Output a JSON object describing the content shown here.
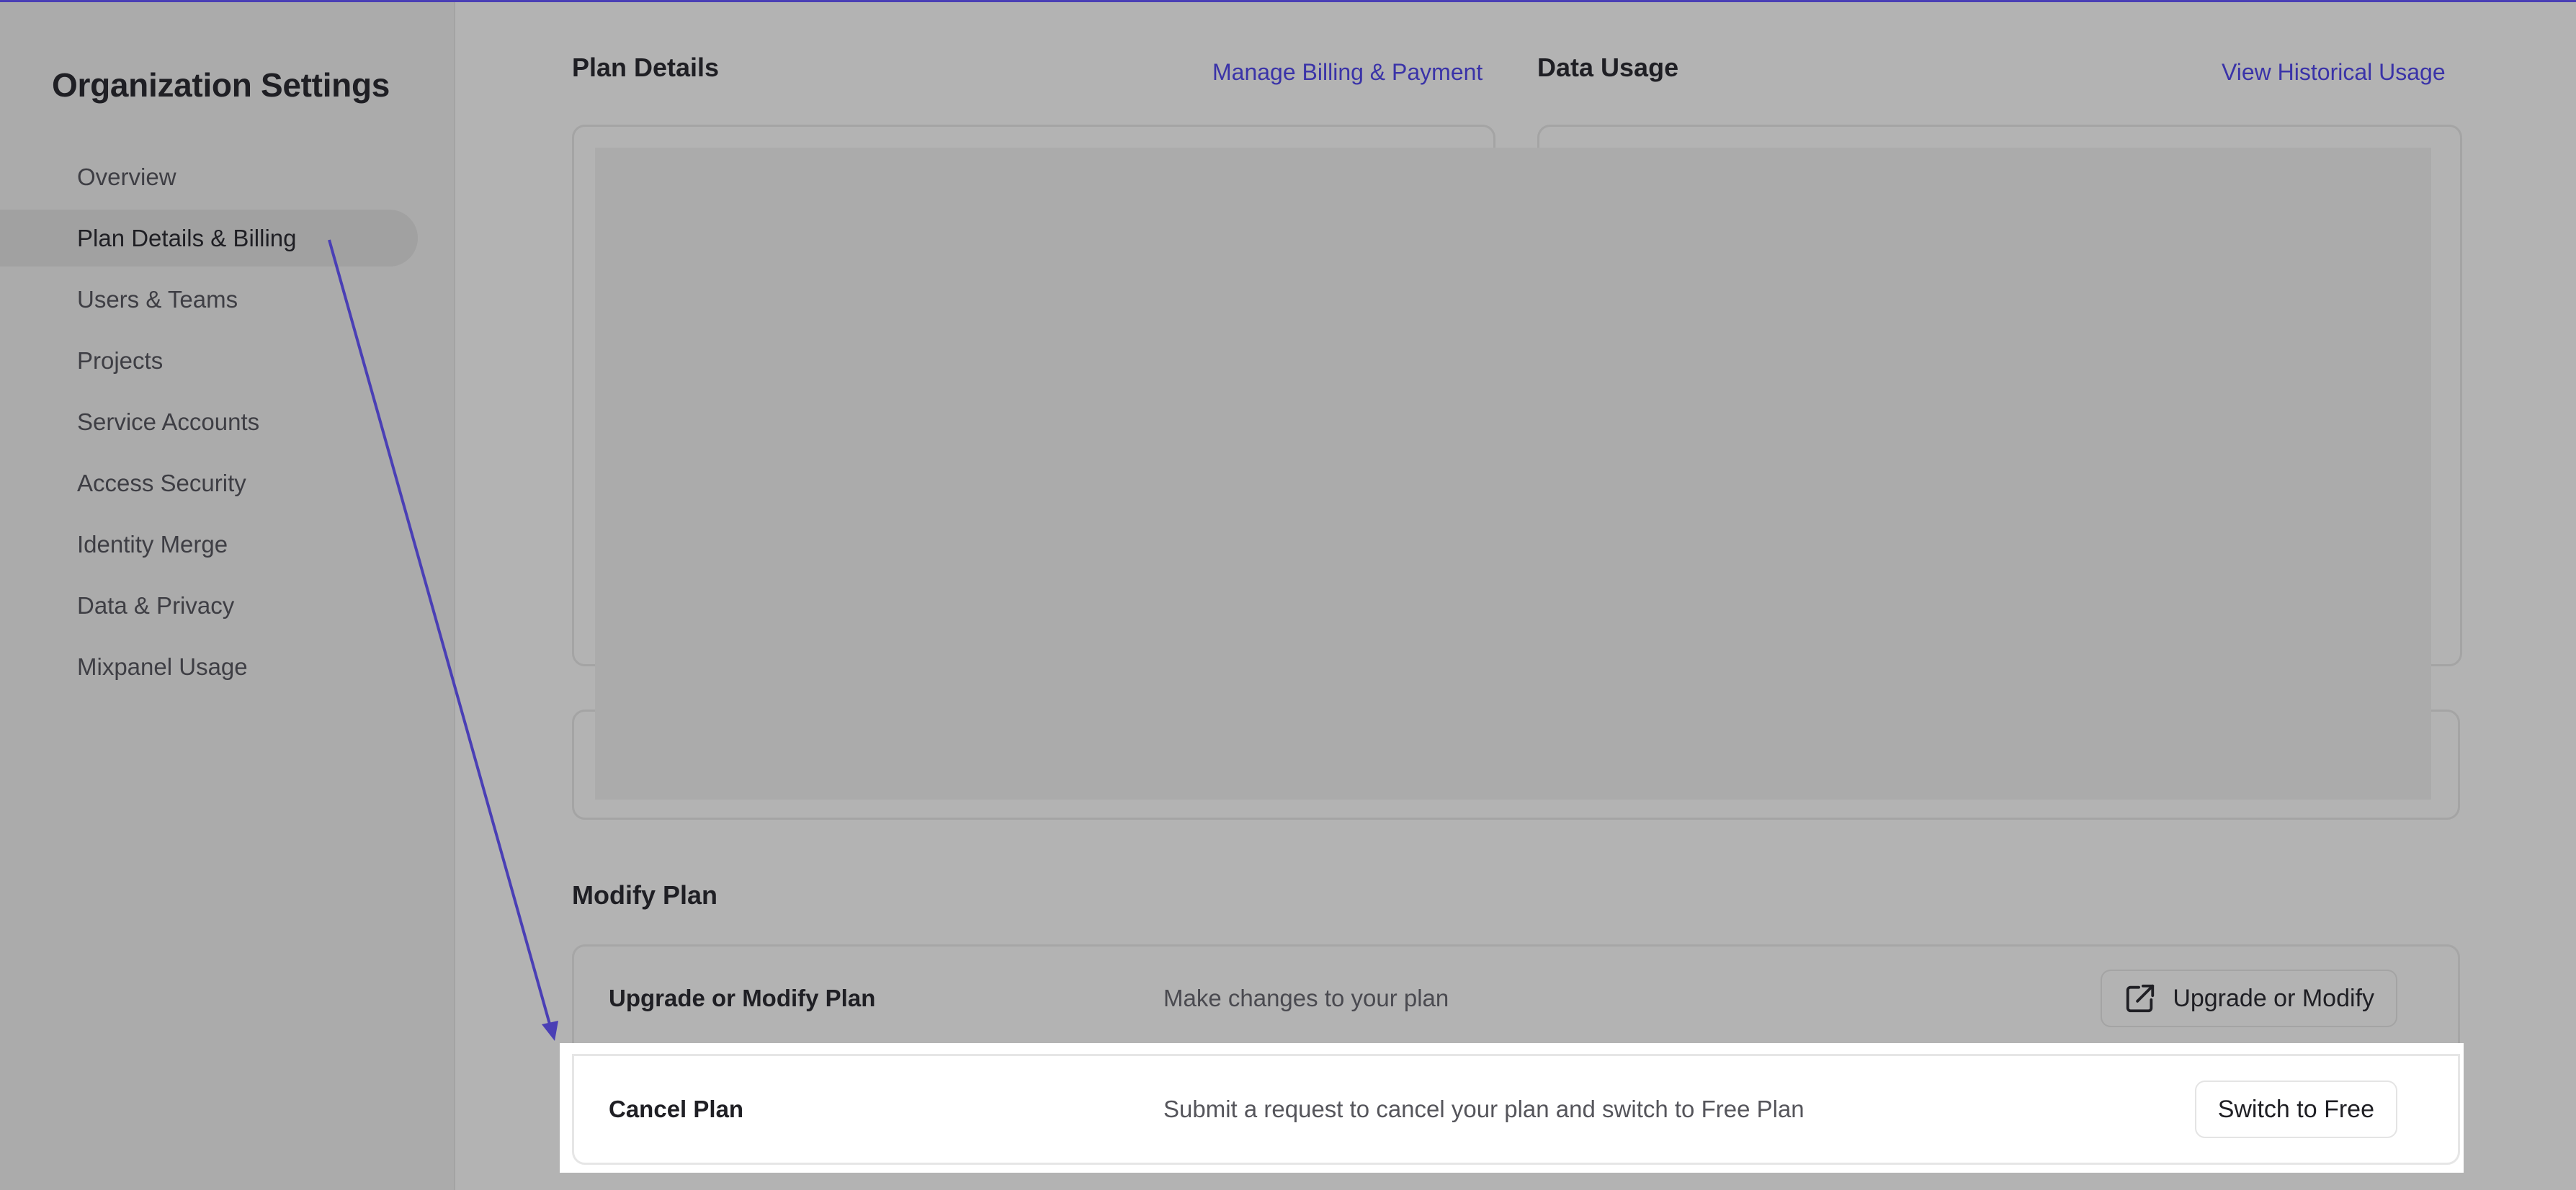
{
  "colors": {
    "accent": "#4a3fb5",
    "link": "#3a33a8",
    "overlay_background": "#b3b3b3",
    "highlight": "#ffffff"
  },
  "sidebar": {
    "title": "Organization Settings",
    "items": [
      {
        "label": "Overview",
        "active": false
      },
      {
        "label": "Plan Details & Billing",
        "active": true
      },
      {
        "label": "Users & Teams",
        "active": false
      },
      {
        "label": "Projects",
        "active": false
      },
      {
        "label": "Service Accounts",
        "active": false
      },
      {
        "label": "Access Security",
        "active": false
      },
      {
        "label": "Identity Merge",
        "active": false
      },
      {
        "label": "Data & Privacy",
        "active": false
      },
      {
        "label": "Mixpanel Usage",
        "active": false
      }
    ]
  },
  "plan_details": {
    "title": "Plan Details",
    "link": "Manage Billing & Payment"
  },
  "data_usage": {
    "title": "Data Usage",
    "link": "View Historical Usage"
  },
  "modify_plan": {
    "title": "Modify Plan",
    "rows": [
      {
        "label": "Upgrade or Modify Plan",
        "description": "Make changes to your plan",
        "button": "Upgrade or Modify",
        "button_icon": "external-link-icon"
      },
      {
        "label": "Cancel Plan",
        "description": "Submit a request to cancel your plan and switch to Free Plan",
        "button": "Switch to Free"
      }
    ]
  }
}
